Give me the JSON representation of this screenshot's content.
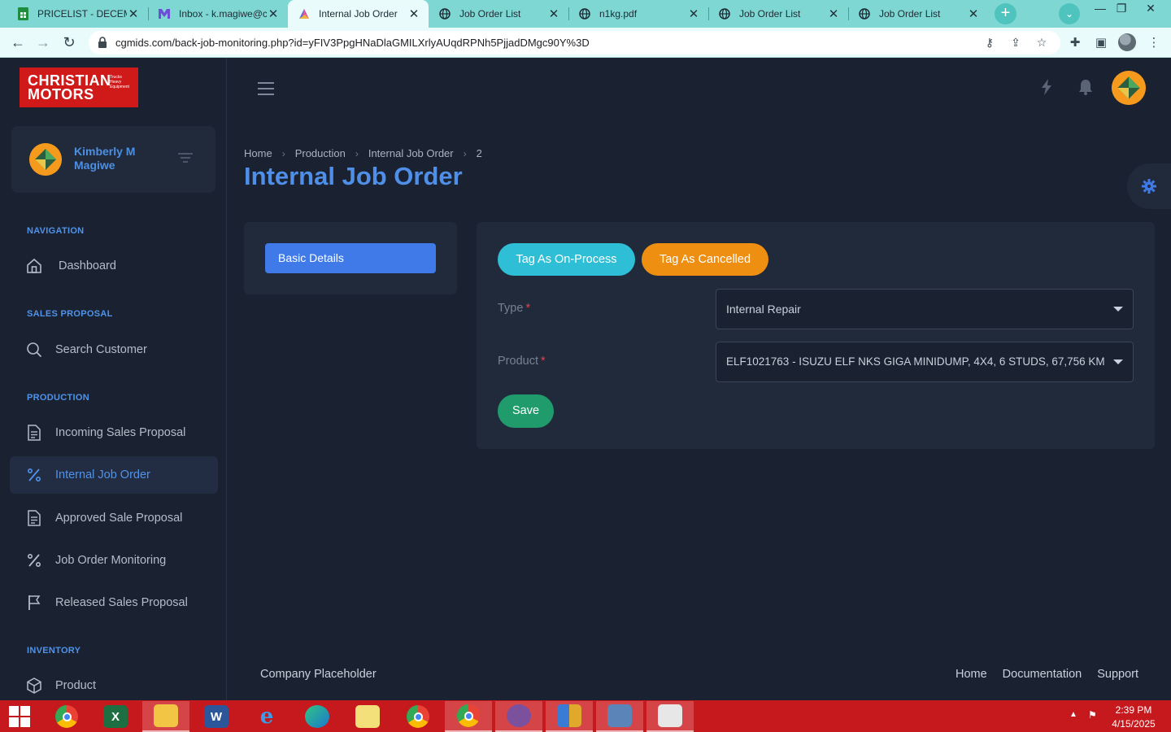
{
  "browser": {
    "tabs": [
      {
        "title": "PRICELIST - DECEMB",
        "icon": "sheets-icon",
        "active": false
      },
      {
        "title": "Inbox - k.magiwe@c",
        "icon": "mail-icon",
        "active": false
      },
      {
        "title": "Internal Job Order",
        "icon": "site-icon",
        "active": true
      },
      {
        "title": "Job Order List",
        "icon": "globe-icon",
        "active": false
      },
      {
        "title": "n1kg.pdf",
        "icon": "globe-icon",
        "active": false
      },
      {
        "title": "Job Order List",
        "icon": "globe-icon",
        "active": false
      },
      {
        "title": "Job Order List",
        "icon": "globe-icon",
        "active": false
      }
    ],
    "new_tab": "+",
    "url": "cgmids.com/back-job-monitoring.php?id=yFIV3PpgHNaDlaGMILXrlyAUqdRPNh5PjjadDMgc90Y%3D"
  },
  "app": {
    "brand": {
      "line1": "CHRISTIAN",
      "line2": "MOTORS",
      "tagline": "Trucks Heavy Equipment"
    },
    "user": {
      "name": "Kimberly M Magiwe"
    },
    "nav": {
      "navigation_heading": "NAVIGATION",
      "dashboard": "Dashboard",
      "sales_heading": "SALES PROPOSAL",
      "search_customer": "Search Customer",
      "production_heading": "PRODUCTION",
      "incoming_sales": "Incoming Sales Proposal",
      "internal_job_order": "Internal Job Order",
      "approved_sale": "Approved Sale Proposal",
      "job_order_monitoring": "Job Order Monitoring",
      "released_sales": "Released Sales Proposal",
      "inventory_heading": "INVENTORY",
      "product": "Product"
    },
    "breadcrumb": {
      "home": "Home",
      "production": "Production",
      "internal": "Internal Job Order",
      "id": "2"
    },
    "page_title": "Internal Job Order",
    "tabs": {
      "basic_details": "Basic Details"
    },
    "actions": {
      "tag_on_process": "Tag As On-Process",
      "tag_cancelled": "Tag As Cancelled",
      "save": "Save"
    },
    "form": {
      "type_label": "Type",
      "type_value": "Internal Repair",
      "product_label": "Product",
      "product_value": "ELF1021763 - ISUZU ELF NKS GIGA MINIDUMP, 4X4, 6 STUDS, 67,756 KM",
      "required_mark": "*"
    },
    "footer": {
      "company": "Company Placeholder",
      "home": "Home",
      "documentation": "Documentation",
      "support": "Support"
    }
  },
  "taskbar": {
    "apps": [
      "chrome-icon",
      "excel-icon",
      "file-explorer-icon",
      "word-icon",
      "internet-explorer-icon",
      "edge-icon",
      "folder-icon",
      "chrome-icon",
      "chrome-icon",
      "viber-icon",
      "app-icon",
      "calculator-icon",
      "news-icon"
    ],
    "time": "2:39 PM",
    "date": "4/15/2025"
  },
  "colors": {
    "accent": "#4f8fe8",
    "primary_button": "#3f7ae8",
    "info_pill": "#2ebfd7",
    "warning_pill": "#ef8f12",
    "success_button": "#1f9b6c",
    "background": "#1a2232",
    "panel": "#202a3b",
    "taskbar": "#c5191e",
    "tabstrip": "#7fd7d4"
  }
}
